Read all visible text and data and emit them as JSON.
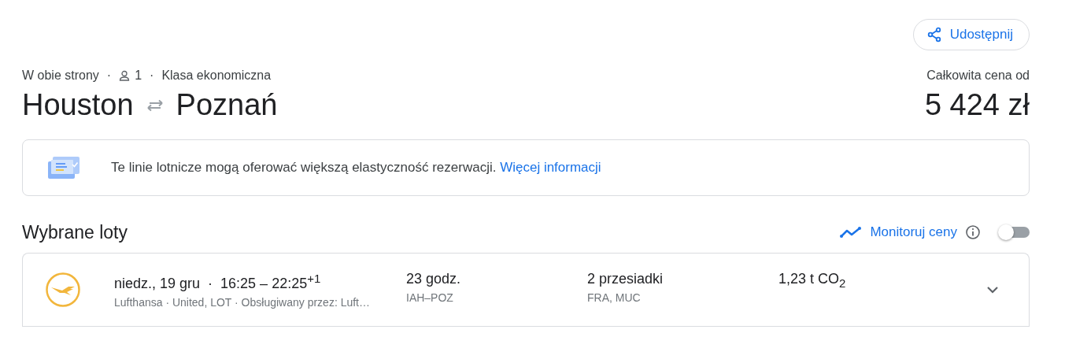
{
  "share_button": {
    "label": "Udostępnij"
  },
  "trip": {
    "separator": "·",
    "type": "W obie strony",
    "passengers": "1",
    "cabin": "Klasa ekonomiczna",
    "origin": "Houston",
    "destination": "Poznań"
  },
  "price": {
    "label": "Całkowita cena od",
    "amount": "5 424 zł"
  },
  "notice": {
    "text": "Te linie lotnicze mogą oferować większą elastyczność rezerwacji.",
    "link": "Więcej informacji"
  },
  "selected_flights": {
    "title": "Wybrane loty",
    "track_prices": {
      "label": "Monitoruj ceny",
      "on": false
    }
  },
  "flights": [
    {
      "date_time": "niedz., 19 gru  ·  16:25 – 22:25$^{+1}$",
      "airlines": "Lufthansa · United, LOT · Obsługiwany przez: Luft…",
      "duration": "23 godz.",
      "route": "IAH–POZ",
      "stops": "2 przesiadki",
      "stop_airports": "FRA, MUC",
      "emissions": "1,23 t CO$_{2}$",
      "expanded": false
    }
  ]
}
